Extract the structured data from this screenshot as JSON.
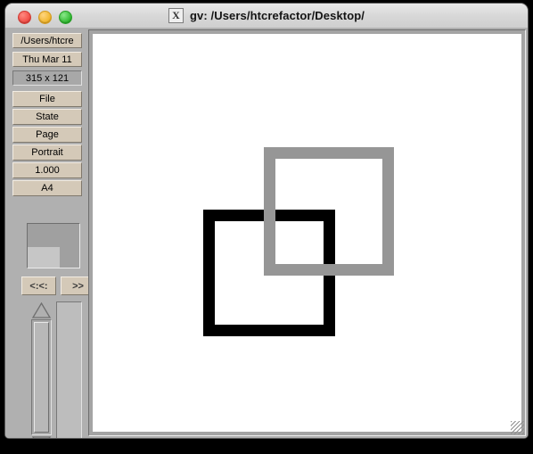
{
  "window": {
    "title": "gv: /Users/htcrefactor/Desktop/",
    "app_icon": "x11-icon",
    "app_icon_glyph": "X",
    "traffic_lights": [
      {
        "name": "close",
        "color": "#f04a43"
      },
      {
        "name": "minimize",
        "color": "#f0b429"
      },
      {
        "name": "zoom",
        "color": "#2eb82e"
      }
    ]
  },
  "sidebar": {
    "path_field": "/Users/htcre",
    "date_field": "Thu Mar 11",
    "size_label": "315 x 121",
    "menu_buttons": [
      {
        "label": "File",
        "name": "file-menu-button"
      },
      {
        "label": "State",
        "name": "state-menu-button"
      },
      {
        "label": "Page",
        "name": "page-menu-button"
      },
      {
        "label": "Portrait",
        "name": "orientation-menu-button"
      },
      {
        "label": "1.000",
        "name": "scale-menu-button"
      },
      {
        "label": "A4",
        "name": "media-menu-button"
      }
    ],
    "nav": {
      "prev_label": "<:<:",
      "next_label": ">>"
    }
  },
  "canvas": {
    "background": "#ffffff",
    "shapes": [
      {
        "name": "gray-square",
        "color": "#969696",
        "stroke": 13
      },
      {
        "name": "black-square",
        "color": "#000000",
        "stroke": 13
      }
    ]
  }
}
